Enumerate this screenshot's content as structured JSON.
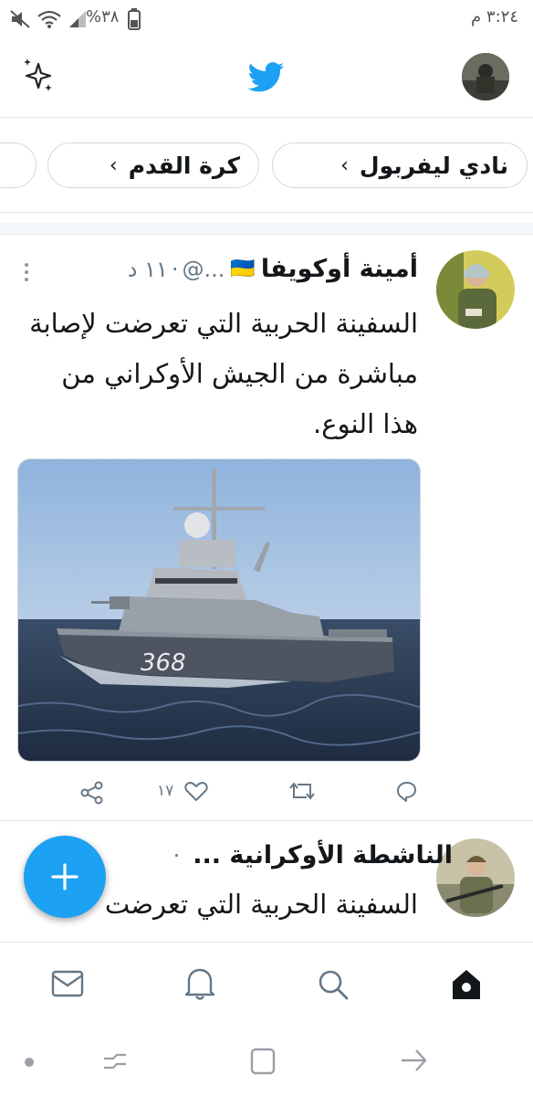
{
  "status_bar": {
    "time": "٣:٢٤ م",
    "battery": "%٣٨"
  },
  "header": {
    "sparkle_icon": "sparkle-icon",
    "logo_icon": "twitter-bird-icon",
    "brand_color": "#1da1f2"
  },
  "topics": [
    {
      "label": "نادي ليفربول"
    },
    {
      "label": "كرة القدم"
    }
  ],
  "tweets": [
    {
      "name": "أمينة أوكويفا",
      "flag": "🇺🇦",
      "handle": "...@",
      "time": "١١ د",
      "separator": "·",
      "text": "السفينة الحربية التي تعرضت لإصابة مباشرة من الجيش الأوكراني من هذا النوع.",
      "ship_number": "368",
      "likes": "١٧"
    },
    {
      "name": "الناشطة الأوكرانية ...",
      "separator": "·",
      "text": "السفينة الحربية التي تعرضت"
    }
  ],
  "bottom_nav": {
    "home": "home-icon",
    "search": "search-icon",
    "notifications": "bell-icon",
    "messages": "mail-icon"
  }
}
